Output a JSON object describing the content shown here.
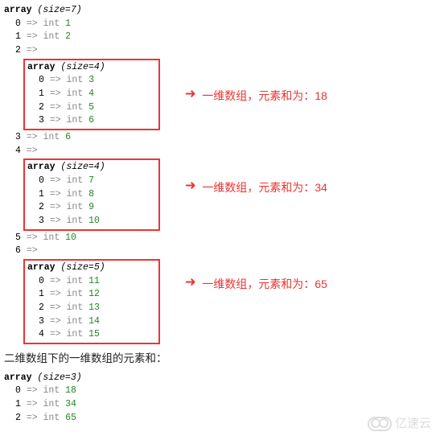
{
  "top": {
    "kw": "array",
    "size": "(size=7)",
    "rows": [
      {
        "idx": "0",
        "arr": "=>",
        "type": "int",
        "val": "1"
      },
      {
        "idx": "1",
        "arr": "=>",
        "type": "int",
        "val": "2"
      },
      {
        "idx": "2",
        "arr": "=>",
        "type": "",
        "val": ""
      }
    ]
  },
  "box1": {
    "kw": "array",
    "size": "(size=4)",
    "rows": [
      {
        "idx": "0",
        "arr": "=>",
        "type": "int",
        "val": "3"
      },
      {
        "idx": "1",
        "arr": "=>",
        "type": "int",
        "val": "4"
      },
      {
        "idx": "2",
        "arr": "=>",
        "type": "int",
        "val": "5"
      },
      {
        "idx": "3",
        "arr": "=>",
        "type": "int",
        "val": "6"
      }
    ]
  },
  "mid1": [
    {
      "idx": "3",
      "arr": "=>",
      "type": "int",
      "val": "6"
    },
    {
      "idx": "4",
      "arr": "=>",
      "type": "",
      "val": ""
    }
  ],
  "box2": {
    "kw": "array",
    "size": "(size=4)",
    "rows": [
      {
        "idx": "0",
        "arr": "=>",
        "type": "int",
        "val": "7"
      },
      {
        "idx": "1",
        "arr": "=>",
        "type": "int",
        "val": "8"
      },
      {
        "idx": "2",
        "arr": "=>",
        "type": "int",
        "val": "9"
      },
      {
        "idx": "3",
        "arr": "=>",
        "type": "int",
        "val": "10"
      }
    ]
  },
  "mid2": [
    {
      "idx": "5",
      "arr": "=>",
      "type": "int",
      "val": "10"
    },
    {
      "idx": "6",
      "arr": "=>",
      "type": "",
      "val": ""
    }
  ],
  "box3": {
    "kw": "array",
    "size": "(size=5)",
    "rows": [
      {
        "idx": "0",
        "arr": "=>",
        "type": "int",
        "val": "11"
      },
      {
        "idx": "1",
        "arr": "=>",
        "type": "int",
        "val": "12"
      },
      {
        "idx": "2",
        "arr": "=>",
        "type": "int",
        "val": "13"
      },
      {
        "idx": "3",
        "arr": "=>",
        "type": "int",
        "val": "14"
      },
      {
        "idx": "4",
        "arr": "=>",
        "type": "int",
        "val": "15"
      }
    ]
  },
  "annotations": {
    "a1": "一维数组，元素和为：18",
    "a2": "一维数组，元素和为：34",
    "a3": "一维数组，元素和为：65"
  },
  "section_title": "二维数组下的一维数组的元素和：",
  "result": {
    "kw": "array",
    "size": "(size=3)",
    "rows": [
      {
        "idx": "0",
        "arr": "=>",
        "type": "int",
        "val": "18"
      },
      {
        "idx": "1",
        "arr": "=>",
        "type": "int",
        "val": "34"
      },
      {
        "idx": "2",
        "arr": "=>",
        "type": "int",
        "val": "65"
      }
    ]
  },
  "watermark": "亿速云",
  "chart_data": {
    "type": "table",
    "title": "PHP var_dump of nested array and per-subarray sums",
    "outer_size": 7,
    "outer": [
      1,
      2,
      [
        3,
        4,
        5,
        6
      ],
      6,
      [
        7,
        8,
        9,
        10
      ],
      10,
      [
        11,
        12,
        13,
        14,
        15
      ]
    ],
    "subarray_sums": [
      18,
      34,
      65
    ],
    "result_size": 3
  }
}
